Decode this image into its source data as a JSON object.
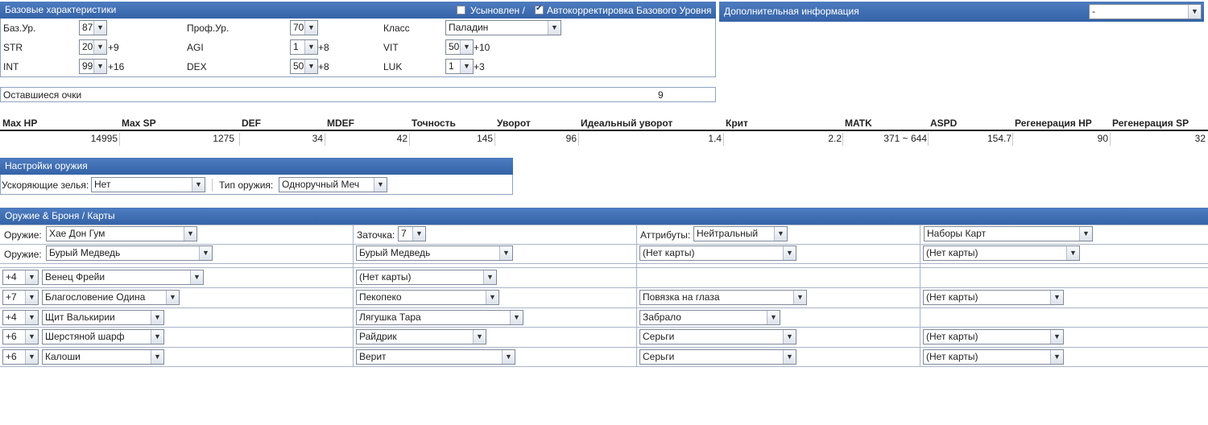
{
  "base": {
    "title": "Базовые характеристики",
    "adopted_label": "Усыновлен /",
    "adopted_checked": false,
    "autocorrect_label": "Автокорректировка Базового Уровня",
    "autocorrect_checked": true,
    "base_lv_label": "Баз.Ур.",
    "base_lv": "87",
    "job_lv_label": "Проф.Ур.",
    "job_lv": "70",
    "class_label": "Класс",
    "class": "Паладин",
    "str_label": "STR",
    "str": "20",
    "str_bonus": "+9",
    "agi_label": "AGI",
    "agi": "1",
    "agi_bonus": "+8",
    "vit_label": "VIT",
    "vit": "50",
    "vit_bonus": "+10",
    "int_label": "INT",
    "int": "99",
    "int_bonus": "+16",
    "dex_label": "DEX",
    "dex": "50",
    "dex_bonus": "+8",
    "luk_label": "LUK",
    "luk": "1",
    "luk_bonus": "+3",
    "points_label": "Оставшиеся очки",
    "points": "9"
  },
  "extra": {
    "title": "Дополнительная информация",
    "select": "-"
  },
  "stats": {
    "headers": [
      "Max HP",
      "Max SP",
      "DEF",
      "MDEF",
      "Точность",
      "Уворот",
      "Идеальный уворот",
      "Крит",
      "MATK",
      "ASPD",
      "Регенерация HP",
      "Регенерация SP"
    ],
    "values": [
      "14995",
      "1275",
      "34",
      "42",
      "145",
      "96",
      "1.4",
      "2.2",
      "371 ~ 644",
      "154.7",
      "90",
      "32"
    ]
  },
  "weapon_settings": {
    "title": "Настройки оружия",
    "potion_label": "Ускоряющие зелья:",
    "potion": "Нет",
    "type_label": "Тип оружия:",
    "type": "Одноручный Меч"
  },
  "equip": {
    "title": "Оружие & Броня / Карты",
    "weapon_label": "Оружие:",
    "weapon1": "Хае Дон Гум",
    "refine_label": "Заточка:",
    "refine": "7",
    "attr_label": "Аттрибуты:",
    "attr": "Нейтральный",
    "card_sets": "Наборы Карт",
    "weapon2": "Бурый Медведь",
    "w_card1": "Бурый Медведь",
    "w_card2": "(Нет карты)",
    "w_card3": "(Нет карты)",
    "armor": [
      {
        "refine": "+4",
        "item": "Венец Фрейи",
        "card1": "(Нет карты)",
        "card2": "",
        "card3": ""
      },
      {
        "refine": "+7",
        "item": "Благословение Одина",
        "card1": "Пекопеко",
        "card2": "Повязка на глаза",
        "card3": "(Нет карты)"
      },
      {
        "refine": "+4",
        "item": "Щит Валькирии",
        "card1": "Лягушка Тара",
        "card2": "Забрало",
        "card3": ""
      },
      {
        "refine": "+6",
        "item": "Шерстяной шарф",
        "card1": "Райдрик",
        "card2": "Серьги",
        "card3": "(Нет карты)"
      },
      {
        "refine": "+6",
        "item": "Калоши",
        "card1": "Верит",
        "card2": "Серьги",
        "card3": "(Нет карты)"
      }
    ]
  }
}
